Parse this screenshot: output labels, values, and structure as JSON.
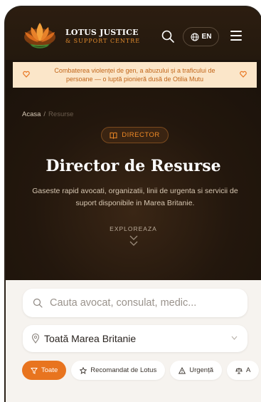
{
  "header": {
    "brand_line1": "LOTUS JUSTICE",
    "brand_line2": "& SUPPORT CENTRE",
    "lang_label": "EN",
    "accent_color": "#e8741f"
  },
  "banner": {
    "text": "Combaterea violenței de gen, a abuzului și a traficului de persoane — o luptă pionieră dusă de Otilia Mutu"
  },
  "breadcrumb": {
    "home": "Acasa",
    "separator": "/",
    "current": "Resurse"
  },
  "hero": {
    "badge_label": "DIRECTOR",
    "title": "Director de Resurse",
    "subtitle": "Gaseste rapid avocati, organizatii, linii de urgenta si servicii de suport disponibile in Marea Britanie.",
    "explore_label": "EXPLOREAZA"
  },
  "search": {
    "placeholder": "Cauta avocat, consulat, medic...",
    "region_value": "Toată Marea Britanie"
  },
  "filters": [
    {
      "label": "Toate",
      "icon": "filter-icon",
      "active": true
    },
    {
      "label": "Recomandat de Lotus",
      "icon": "star-icon",
      "active": false
    },
    {
      "label": "Urgență",
      "icon": "warning-icon",
      "active": false
    },
    {
      "label": "A",
      "icon": "scales-icon",
      "active": false
    }
  ]
}
